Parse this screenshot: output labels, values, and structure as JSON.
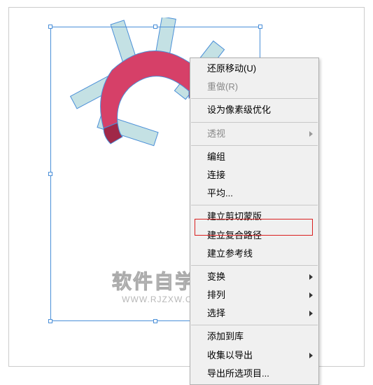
{
  "menu": {
    "undo_move": "还原移动(U)",
    "redo": "重做(R)",
    "pixel_optimize": "设为像素级优化",
    "perspective": "透视",
    "group": "编组",
    "join": "连接",
    "average": "平均...",
    "make_clipping_mask": "建立剪切蒙版",
    "make_compound_path": "建立复合路径",
    "make_guides": "建立参考线",
    "transform": "变换",
    "arrange": "排列",
    "select": "选择",
    "add_to_library": "添加到库",
    "collect_export": "收集以导出",
    "export_selection": "导出所选项目..."
  },
  "watermark": {
    "line1": "软件自学网",
    "line2": "WWW.RJZXW.COM"
  }
}
